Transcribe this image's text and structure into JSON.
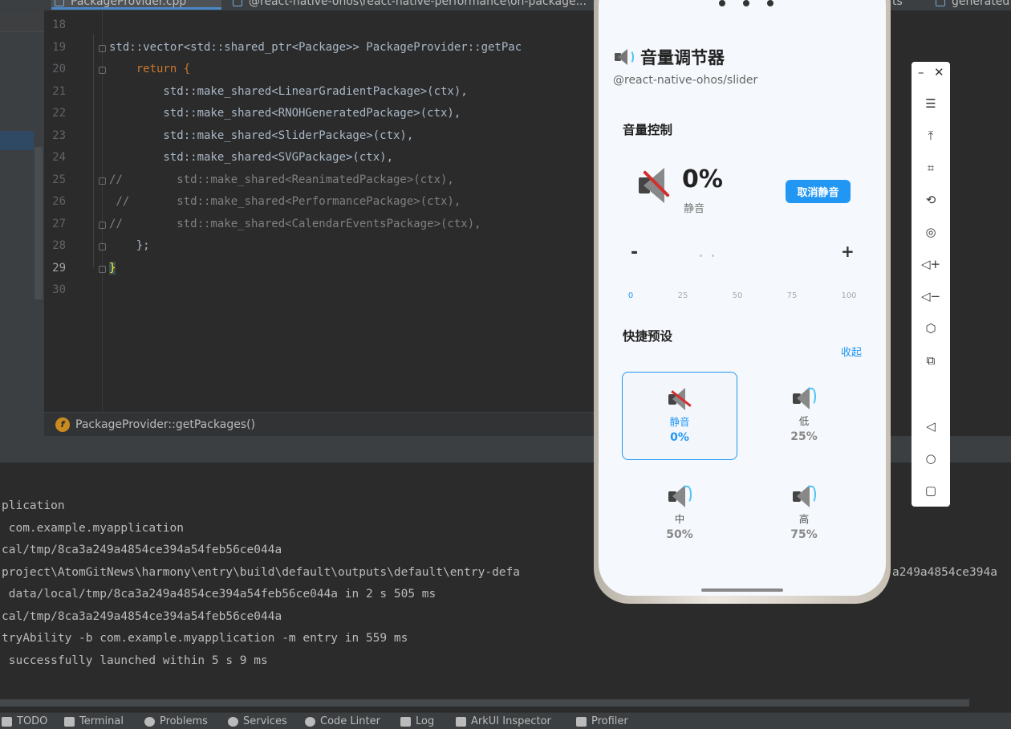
{
  "ide": {
    "tabs": [
      {
        "label": "PackageProvider.cpp",
        "active": true
      },
      {
        "label": "@react-native-ohos\\react-native-performance\\oh-package...",
        "active": false
      },
      {
        "label": "ts",
        "active": false
      },
      {
        "label": "generated",
        "active": false
      }
    ],
    "code_lines": [
      {
        "n": "18",
        "text": ""
      },
      {
        "n": "19",
        "text": "std::vector<std::shared_ptr<Package>> PackageProvider::getPac"
      },
      {
        "n": "20",
        "text": "    return {"
      },
      {
        "n": "21",
        "text": "        std::make_shared<LinearGradientPackage>(ctx),"
      },
      {
        "n": "22",
        "text": "        std::make_shared<RNOHGeneratedPackage>(ctx),"
      },
      {
        "n": "23",
        "text": "        std::make_shared<SliderPackage>(ctx),"
      },
      {
        "n": "24",
        "text": "        std::make_shared<SVGPackage>(ctx),"
      },
      {
        "n": "25",
        "text": "//        std::make_shared<ReanimatedPackage>(ctx),"
      },
      {
        "n": "26",
        "text": " //       std::make_shared<PerformancePackage>(ctx),"
      },
      {
        "n": "27",
        "text": "//        std::make_shared<CalendarEventsPackage>(ctx),"
      },
      {
        "n": "28",
        "text": "    };"
      },
      {
        "n": "29",
        "text": "}"
      },
      {
        "n": "30",
        "text": ""
      }
    ],
    "breadcrumb": {
      "badge": "f",
      "label": "PackageProvider::getPackages()"
    },
    "console_lines": [
      "plication",
      " com.example.myapplication",
      "cal/tmp/8ca3a249a4854ce394a54feb56ce044a",
      "project\\AtomGitNews\\harmony\\entry\\build\\default\\outputs\\default\\entry-defa",
      " data/local/tmp/8ca3a249a4854ce394a54feb56ce044a in 2 s 505 ms",
      "cal/tmp/8ca3a249a4854ce394a54feb56ce044a",
      "tryAbility -b com.example.myapplication -m entry in 559 ms",
      " successfully launched within 5 s 9 ms"
    ],
    "console_overflow": "a249a4854ce394a",
    "status_items": [
      "TODO",
      "Terminal",
      "Problems",
      "Services",
      "Code Linter",
      "Log",
      "ArkUI Inspector",
      "Profiler"
    ]
  },
  "app": {
    "title": "音量调节器",
    "subtitle": "@react-native-ohos/slider",
    "volume_section": "音量控制",
    "volume_value": "0%",
    "volume_state": "静音",
    "unmute_label": "取消静音",
    "minus_label": "-",
    "plus_label": "+",
    "ticks": [
      "0",
      "25",
      "50",
      "75",
      "100"
    ],
    "volume_fraction": 0,
    "presets_section": "快捷预设",
    "collapse_label": "收起",
    "presets": [
      {
        "name": "静音",
        "value": "0%",
        "selected": true
      },
      {
        "name": "低",
        "value": "25%",
        "selected": false
      },
      {
        "name": "中",
        "value": "50%",
        "selected": false
      },
      {
        "name": "高",
        "value": "75%",
        "selected": false
      }
    ],
    "accent": "#2196f3"
  },
  "emulator": {
    "buttons": [
      "minimize-icon",
      "close-icon",
      "menu-icon",
      "pin-top-icon",
      "crop-icon",
      "rotate-icon",
      "screenshot-icon",
      "volume-up-icon",
      "volume-down-icon",
      "shake-icon",
      "multi-screen-icon",
      "back-icon",
      "home-icon",
      "recents-icon"
    ]
  }
}
